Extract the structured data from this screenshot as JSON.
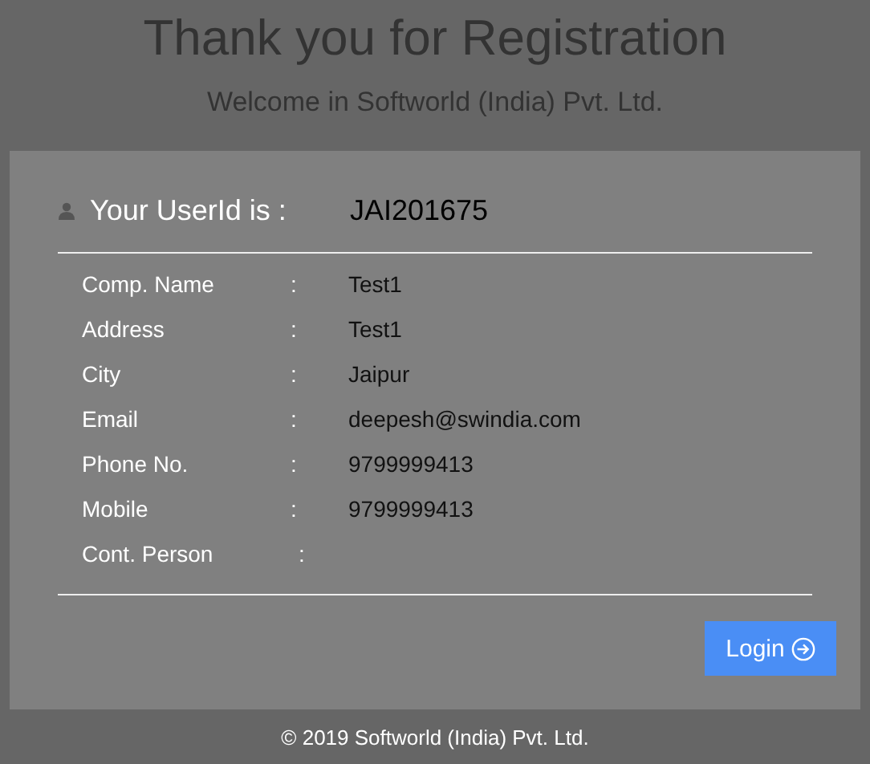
{
  "header": {
    "title": "Thank you for Registration",
    "subtitle": "Welcome in Softworld (India) Pvt. Ltd."
  },
  "userid": {
    "label": "Your UserId is :",
    "value": "JAI201675"
  },
  "details": [
    {
      "label": "Comp. Name",
      "separator": ":",
      "value": "Test1"
    },
    {
      "label": "Address",
      "separator": ":",
      "value": "Test1"
    },
    {
      "label": "City",
      "separator": ":",
      "value": "Jaipur"
    },
    {
      "label": "Email",
      "separator": ":",
      "value": "deepesh@swindia.com"
    },
    {
      "label": "Phone No.",
      "separator": ":",
      "value": "9799999413"
    },
    {
      "label": "Mobile",
      "separator": ":",
      "value": "9799999413"
    },
    {
      "label": "Cont. Person",
      "separator": ":"
    }
  ],
  "login_button": {
    "label": "Login"
  },
  "footer": "© 2019 Softworld (India) Pvt. Ltd."
}
